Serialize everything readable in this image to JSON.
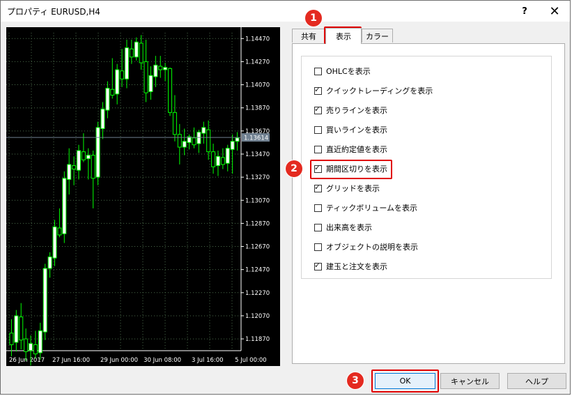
{
  "window": {
    "title": "プロパティ EURUSD,H4",
    "help_label": "?",
    "close_label": "✕"
  },
  "tabs": [
    {
      "label": "共有",
      "active": false
    },
    {
      "label": "表示",
      "active": true
    },
    {
      "label": "カラー",
      "active": false
    }
  ],
  "options": [
    {
      "label": "OHLCを表示",
      "checked": false
    },
    {
      "label": "クイックトレーディングを表示",
      "checked": true
    },
    {
      "label": "売りラインを表示",
      "checked": true
    },
    {
      "label": "買いラインを表示",
      "checked": false
    },
    {
      "label": "直近約定値を表示",
      "checked": false
    },
    {
      "label": "期間区切りを表示",
      "checked": true
    },
    {
      "label": "グリッドを表示",
      "checked": true
    },
    {
      "label": "ティックボリュームを表示",
      "checked": false
    },
    {
      "label": "出来高を表示",
      "checked": false
    },
    {
      "label": "オブジェクトの説明を表示",
      "checked": false
    },
    {
      "label": "建玉と注文を表示",
      "checked": true
    }
  ],
  "buttons": {
    "ok": "OK",
    "cancel": "キャンセル",
    "help": "ヘルプ"
  },
  "badges": [
    "1",
    "2",
    "3"
  ],
  "colors": {
    "chart_bg": "#000000",
    "bull_candle": "#ffffff",
    "wick": "#00ff00",
    "grid": "#4a6a4a",
    "bid_line": "#708090",
    "highlight": "#e00000"
  },
  "chart_data": {
    "type": "candlestick",
    "symbol": "EURUSD",
    "timeframe": "H4",
    "ylim": [
      1.1178,
      1.1452
    ],
    "y_ticks": [
      "1.14470",
      "1.14270",
      "1.14070",
      "1.13870",
      "1.13670",
      "1.13470",
      "1.13270",
      "1.13070",
      "1.12870",
      "1.12670",
      "1.12470",
      "1.12270",
      "1.12070",
      "1.11870"
    ],
    "x_ticks": [
      "26 Jun 2017",
      "27 Jun 16:00",
      "29 Jun 00:00",
      "30 Jun 08:00",
      "3 Jul 16:00",
      "5 Jul 00:00"
    ],
    "bid_price": "1.13614",
    "candles": [
      [
        1.1192,
        1.1204,
        1.1172,
        1.1182
      ],
      [
        1.1184,
        1.1212,
        1.1176,
        1.1207
      ],
      [
        1.1206,
        1.1218,
        1.1178,
        1.1186
      ],
      [
        1.1187,
        1.1196,
        1.1168,
        1.1176
      ],
      [
        1.1177,
        1.119,
        1.1164,
        1.1183
      ],
      [
        1.1182,
        1.1194,
        1.117,
        1.1174
      ],
      [
        1.1175,
        1.1201,
        1.1169,
        1.1194
      ],
      [
        1.1193,
        1.1252,
        1.1186,
        1.1248
      ],
      [
        1.1248,
        1.1262,
        1.124,
        1.1258
      ],
      [
        1.1257,
        1.129,
        1.125,
        1.1284
      ],
      [
        1.1283,
        1.13,
        1.1275,
        1.1277
      ],
      [
        1.1278,
        1.1332,
        1.127,
        1.1326
      ],
      [
        1.1325,
        1.1352,
        1.1312,
        1.1338
      ],
      [
        1.1337,
        1.1345,
        1.132,
        1.1334
      ],
      [
        1.1333,
        1.1355,
        1.1325,
        1.135
      ],
      [
        1.1349,
        1.1365,
        1.134,
        1.1342
      ],
      [
        1.1343,
        1.1352,
        1.1325,
        1.1346
      ],
      [
        1.1346,
        1.135,
        1.13,
        1.1326
      ],
      [
        1.1327,
        1.1375,
        1.132,
        1.137
      ],
      [
        1.1369,
        1.1392,
        1.136,
        1.1386
      ],
      [
        1.1385,
        1.141,
        1.1378,
        1.1404
      ],
      [
        1.1403,
        1.143,
        1.1395,
        1.1398
      ],
      [
        1.1399,
        1.1425,
        1.139,
        1.142
      ],
      [
        1.1419,
        1.1438,
        1.1405,
        1.1412
      ],
      [
        1.1412,
        1.1446,
        1.1404,
        1.1439
      ],
      [
        1.1438,
        1.1446,
        1.1425,
        1.1431
      ],
      [
        1.1431,
        1.1448,
        1.1428,
        1.1444
      ],
      [
        1.1443,
        1.145,
        1.142,
        1.1426
      ],
      [
        1.1427,
        1.1446,
        1.1392,
        1.14
      ],
      [
        1.1401,
        1.1423,
        1.1394,
        1.1415
      ],
      [
        1.1414,
        1.1432,
        1.1405,
        1.1424
      ],
      [
        1.1423,
        1.1432,
        1.1413,
        1.142
      ],
      [
        1.142,
        1.1426,
        1.141,
        1.1422
      ],
      [
        1.1421,
        1.1422,
        1.138,
        1.1383
      ],
      [
        1.1383,
        1.1398,
        1.1358,
        1.1364
      ],
      [
        1.1364,
        1.1373,
        1.1338,
        1.1353
      ],
      [
        1.1353,
        1.1369,
        1.1346,
        1.1358
      ],
      [
        1.1357,
        1.1364,
        1.1351,
        1.1362
      ],
      [
        1.1361,
        1.137,
        1.1352,
        1.1355
      ],
      [
        1.1356,
        1.1368,
        1.1348,
        1.1366
      ],
      [
        1.1365,
        1.1375,
        1.1356,
        1.137
      ],
      [
        1.1368,
        1.1376,
        1.1342,
        1.1349
      ],
      [
        1.1349,
        1.1356,
        1.133,
        1.1336
      ],
      [
        1.1337,
        1.135,
        1.1328,
        1.1345
      ],
      [
        1.1344,
        1.1352,
        1.1334,
        1.1338
      ],
      [
        1.1339,
        1.1355,
        1.1332,
        1.1352
      ],
      [
        1.1351,
        1.1364,
        1.133,
        1.1358
      ],
      [
        1.1358,
        1.1366,
        1.135,
        1.1361
      ]
    ]
  }
}
